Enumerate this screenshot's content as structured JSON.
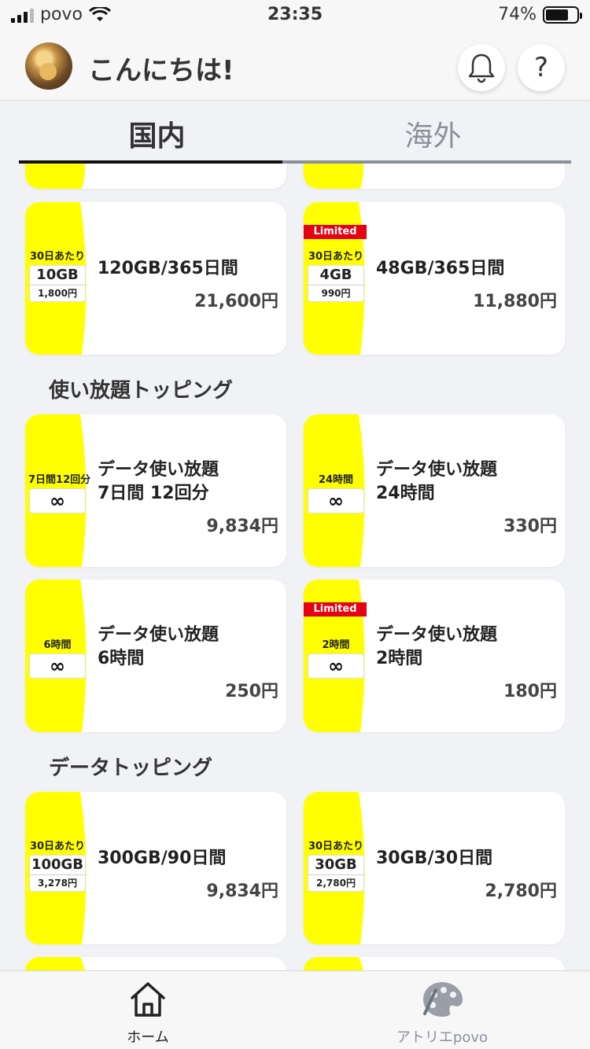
{
  "status_bar": {
    "carrier": "povo",
    "time": "23:35",
    "battery": "74%",
    "battery_level": 0.74
  },
  "header": {
    "greeting": "こんにちは!",
    "bell_icon": "bell-icon",
    "help_label": "?"
  },
  "tabs": [
    {
      "label": "国内",
      "active": true
    },
    {
      "label": "海外",
      "active": false
    }
  ],
  "colors": {
    "accent_yellow": "#ffff00",
    "limited_red": "#e50012",
    "tab_active": "#111111",
    "tab_inactive": "#8a8f99"
  },
  "top_cards": [
    {
      "head": "30日あたり",
      "amount": "10GB",
      "unit_price": "1,800円",
      "title": "120GB/365日間",
      "price": "21,600円",
      "limited": ""
    },
    {
      "head": "30日あたり",
      "amount": "4GB",
      "unit_price": "990円",
      "title": "48GB/365日間",
      "price": "11,880円",
      "limited": "Limited"
    }
  ],
  "sections": [
    {
      "title": "使い放題トッピング"
    },
    {
      "title": "データトッピング"
    }
  ],
  "unlimited_cards": [
    {
      "head": "7日間12回分",
      "symbol": "∞",
      "title": "データ使い放題\n7日間 12回分",
      "price": "9,834円",
      "limited": ""
    },
    {
      "head": "24時間",
      "symbol": "∞",
      "title": "データ使い放題\n24時間",
      "price": "330円",
      "limited": ""
    },
    {
      "head": "6時間",
      "symbol": "∞",
      "title": "データ使い放題\n6時間",
      "price": "250円",
      "limited": ""
    },
    {
      "head": "2時間",
      "symbol": "∞",
      "title": "データ使い放題\n2時間",
      "price": "180円",
      "limited": "Limited"
    }
  ],
  "data_cards": [
    {
      "head": "30日あたり",
      "amount": "100GB",
      "unit_price": "3,278円",
      "title": "300GB/90日間",
      "price": "9,834円"
    },
    {
      "head": "30日あたり",
      "amount": "30GB",
      "unit_price": "2,780円",
      "title": "30GB/30日間",
      "price": "2,780円"
    }
  ],
  "tab_bar": [
    {
      "label": "ホーム",
      "icon": "home-icon",
      "active": true
    },
    {
      "label": "アトリエpovo",
      "icon": "palette-icon",
      "active": false
    }
  ]
}
